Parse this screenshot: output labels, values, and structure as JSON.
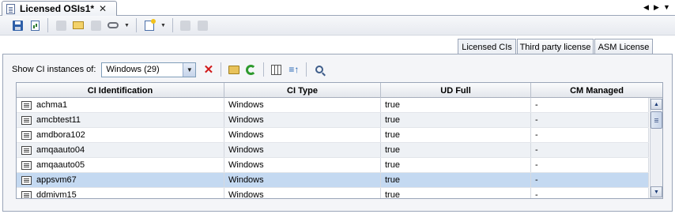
{
  "editor_tab": {
    "title": "Licensed OSIs1*",
    "close_glyph": "✕",
    "icon": "document-icon"
  },
  "nav": {
    "left_glyph": "◀",
    "right_glyph": "▶",
    "menu_glyph": "▼"
  },
  "toolbar": {
    "buttons": [
      {
        "name": "save",
        "icon": "save-disk-icon",
        "enabled": true
      },
      {
        "name": "report",
        "icon": "document-chart-icon",
        "enabled": true
      },
      {
        "name": "disabled-1",
        "icon": "disabled-icon",
        "enabled": false
      },
      {
        "name": "email",
        "icon": "mail-icon",
        "enabled": true
      },
      {
        "name": "disabled-2",
        "icon": "disabled-icon",
        "enabled": false
      },
      {
        "name": "link",
        "icon": "link-icon",
        "enabled": true
      },
      {
        "name": "new",
        "icon": "new-document-icon",
        "enabled": true
      },
      {
        "name": "disabled-3",
        "icon": "disabled-icon",
        "enabled": false
      },
      {
        "name": "disabled-4",
        "icon": "disabled-icon",
        "enabled": false
      }
    ]
  },
  "subtabs": [
    {
      "label": "Licensed CIs",
      "active": true
    },
    {
      "label": "Third party license",
      "active": false
    },
    {
      "label": "ASM License",
      "active": false
    }
  ],
  "filter": {
    "label": "Show CI instances of:",
    "selected": "Windows (29)",
    "arrow_glyph": "▼",
    "delete_glyph": "✕",
    "sort_glyph": "≡↑"
  },
  "table": {
    "columns": [
      "CI Identification",
      "CI Type",
      "UD Full",
      "CM Managed"
    ],
    "rows": [
      {
        "id": "achma1",
        "type": "Windows",
        "ud_full": "true",
        "cm_managed": "-"
      },
      {
        "id": "amcbtest11",
        "type": "Windows",
        "ud_full": "true",
        "cm_managed": "-"
      },
      {
        "id": "amdbora102",
        "type": "Windows",
        "ud_full": "true",
        "cm_managed": "-"
      },
      {
        "id": "amqaauto04",
        "type": "Windows",
        "ud_full": "true",
        "cm_managed": "-"
      },
      {
        "id": "amqaauto05",
        "type": "Windows",
        "ud_full": "true",
        "cm_managed": "-"
      },
      {
        "id": "appsvm67",
        "type": "Windows",
        "ud_full": "true",
        "cm_managed": "-"
      },
      {
        "id": "ddmivm15",
        "type": "Windows",
        "ud_full": "true",
        "cm_managed": "-"
      }
    ],
    "selected_row": "appsvm67"
  },
  "scrollbar": {
    "up_glyph": "▲",
    "down_glyph": "▼"
  },
  "colors": {
    "selection": "#c4d9f1",
    "alt_row": "#eef1f5",
    "border": "#9aa5b8",
    "delete": "#d11a1a",
    "refresh": "#2d9a2d"
  }
}
